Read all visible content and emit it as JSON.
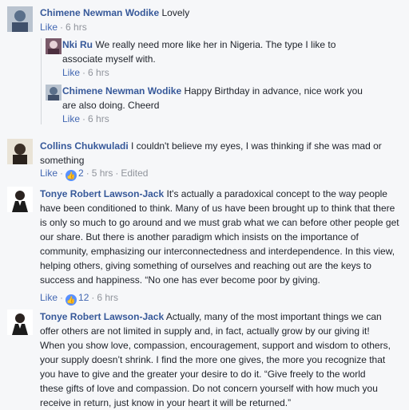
{
  "comments": [
    {
      "name": "Chimene Newman Wodike",
      "text": "Lovely",
      "like_label": "Like",
      "time": "6 hrs"
    },
    {
      "name": "Nki Ru",
      "text": "We really need more like her in Nigeria. The type I like to associate myself with.",
      "like_label": "Like",
      "time": "6 hrs"
    },
    {
      "name": "Chimene Newman Wodike",
      "text": "Happy Birthday in advance, nice work you are also doing. Cheerd",
      "like_label": "Like",
      "time": "6 hrs"
    },
    {
      "name": "Collins Chukwuladi",
      "text": "I couldn't believe my eyes, I was thinking if she was mad or something",
      "like_label": "Like",
      "reactions": "2",
      "time": "5 hrs",
      "edited": "Edited"
    },
    {
      "name": "Tonye Robert Lawson-Jack",
      "text": "It's actually a paradoxical concept to the way people have been conditioned to think. Many of us have been brought up to think that there is only so much to go around and we must grab what we can before other people get our share. But there is another paradigm which insists on the importance of community, emphasizing our interconnectedness and interdependence. In this view, helping others, giving something of ourselves and reaching out are the keys to success and happiness. “No one has ever become poor by giving.",
      "like_label": "Like",
      "reactions": "12",
      "time": "6 hrs"
    },
    {
      "name": "Tonye Robert Lawson-Jack",
      "text": "Actually, many of the most important things we can offer others are not limited in supply and, in fact, actually grow by our giving it! When you show love, compassion, encouragement, support and wisdom to others, your supply doesn’t shrink. I find the more one gives, the more you recognize that you have to give and the greater your desire to do it. “Give freely to the world these gifts of love and compassion. Do not concern yourself with how much you receive in return, just know in your heart it will be returned.”"
    }
  ],
  "icons": {
    "reaction": "like-reaction-icon"
  }
}
